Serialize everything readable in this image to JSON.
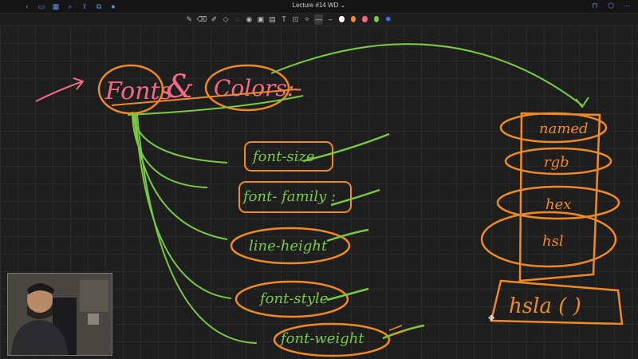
{
  "app": {
    "title": "Lecture #14 WD"
  },
  "colors": {
    "orange": "#f08a24",
    "green": "#7ac943",
    "pink": "#f46a84",
    "accent": "#4f7cf3"
  },
  "toolbar": {
    "tools": [
      "pen-icon",
      "eraser-icon",
      "highlighter-icon",
      "shapes-icon",
      "lasso-icon",
      "hand-icon",
      "image-icon",
      "text-icon",
      "magic-icon"
    ],
    "swatches": [
      "#1e1e1e",
      "#ffffff",
      "#f08a24",
      "#f46a84",
      "#7ac943",
      "#4f7cf3"
    ]
  },
  "notes": {
    "title_fonts": "Fonts",
    "title_amp": "&",
    "title_colors": "Colors:-",
    "font_props": [
      "font-size",
      "font- family :",
      "line-height",
      "font-style",
      "font-weight"
    ],
    "color_formats": [
      "named",
      "rgb",
      "hex",
      "hsl"
    ],
    "hsla": "hsla ( )"
  }
}
